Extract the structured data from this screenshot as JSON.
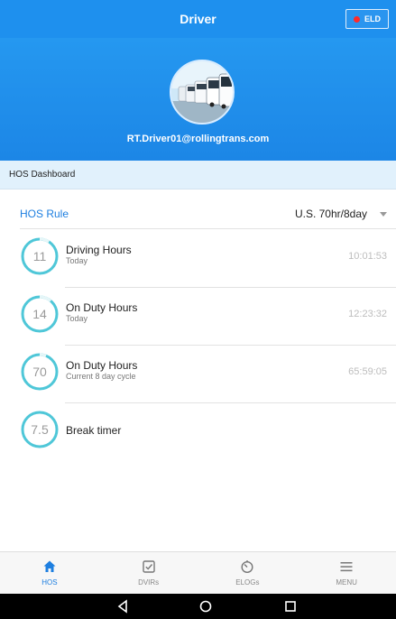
{
  "header": {
    "title": "Driver",
    "eld_label": "ELD",
    "eld_status_color": "#ff2a2a"
  },
  "profile": {
    "email": "RT.Driver01@rollingtrans.com"
  },
  "dashboard": {
    "section_title": "HOS Dashboard"
  },
  "hos_rule": {
    "label": "HOS Rule",
    "value": "U.S. 70hr/8day"
  },
  "hos_items": [
    {
      "number": "11",
      "title": "Driving Hours",
      "subtitle": "Today",
      "time": "10:01:53",
      "progress": 0.09
    },
    {
      "number": "14",
      "title": "On Duty Hours",
      "subtitle": "Today",
      "time": "12:23:32",
      "progress": 0.11
    },
    {
      "number": "70",
      "title": "On Duty Hours",
      "subtitle": "Current 8 day cycle",
      "time": "65:59:05",
      "progress": 0.06
    },
    {
      "number": "7.5",
      "title": "Break timer",
      "subtitle": "",
      "time": "",
      "progress": 0.0
    }
  ],
  "bottom_nav": [
    {
      "label": "HOS",
      "icon": "home-icon",
      "active": true
    },
    {
      "label": "DVIRs",
      "icon": "checkbox-icon",
      "active": false
    },
    {
      "label": "ELOGs",
      "icon": "timer-icon",
      "active": false
    },
    {
      "label": "MENU",
      "icon": "hamburger-icon",
      "active": false
    }
  ],
  "colors": {
    "primary": "#1e90ee",
    "ring": "#4fc7d8",
    "ring_track": "#d9f2f5",
    "active_nav": "#1e7fe0"
  }
}
